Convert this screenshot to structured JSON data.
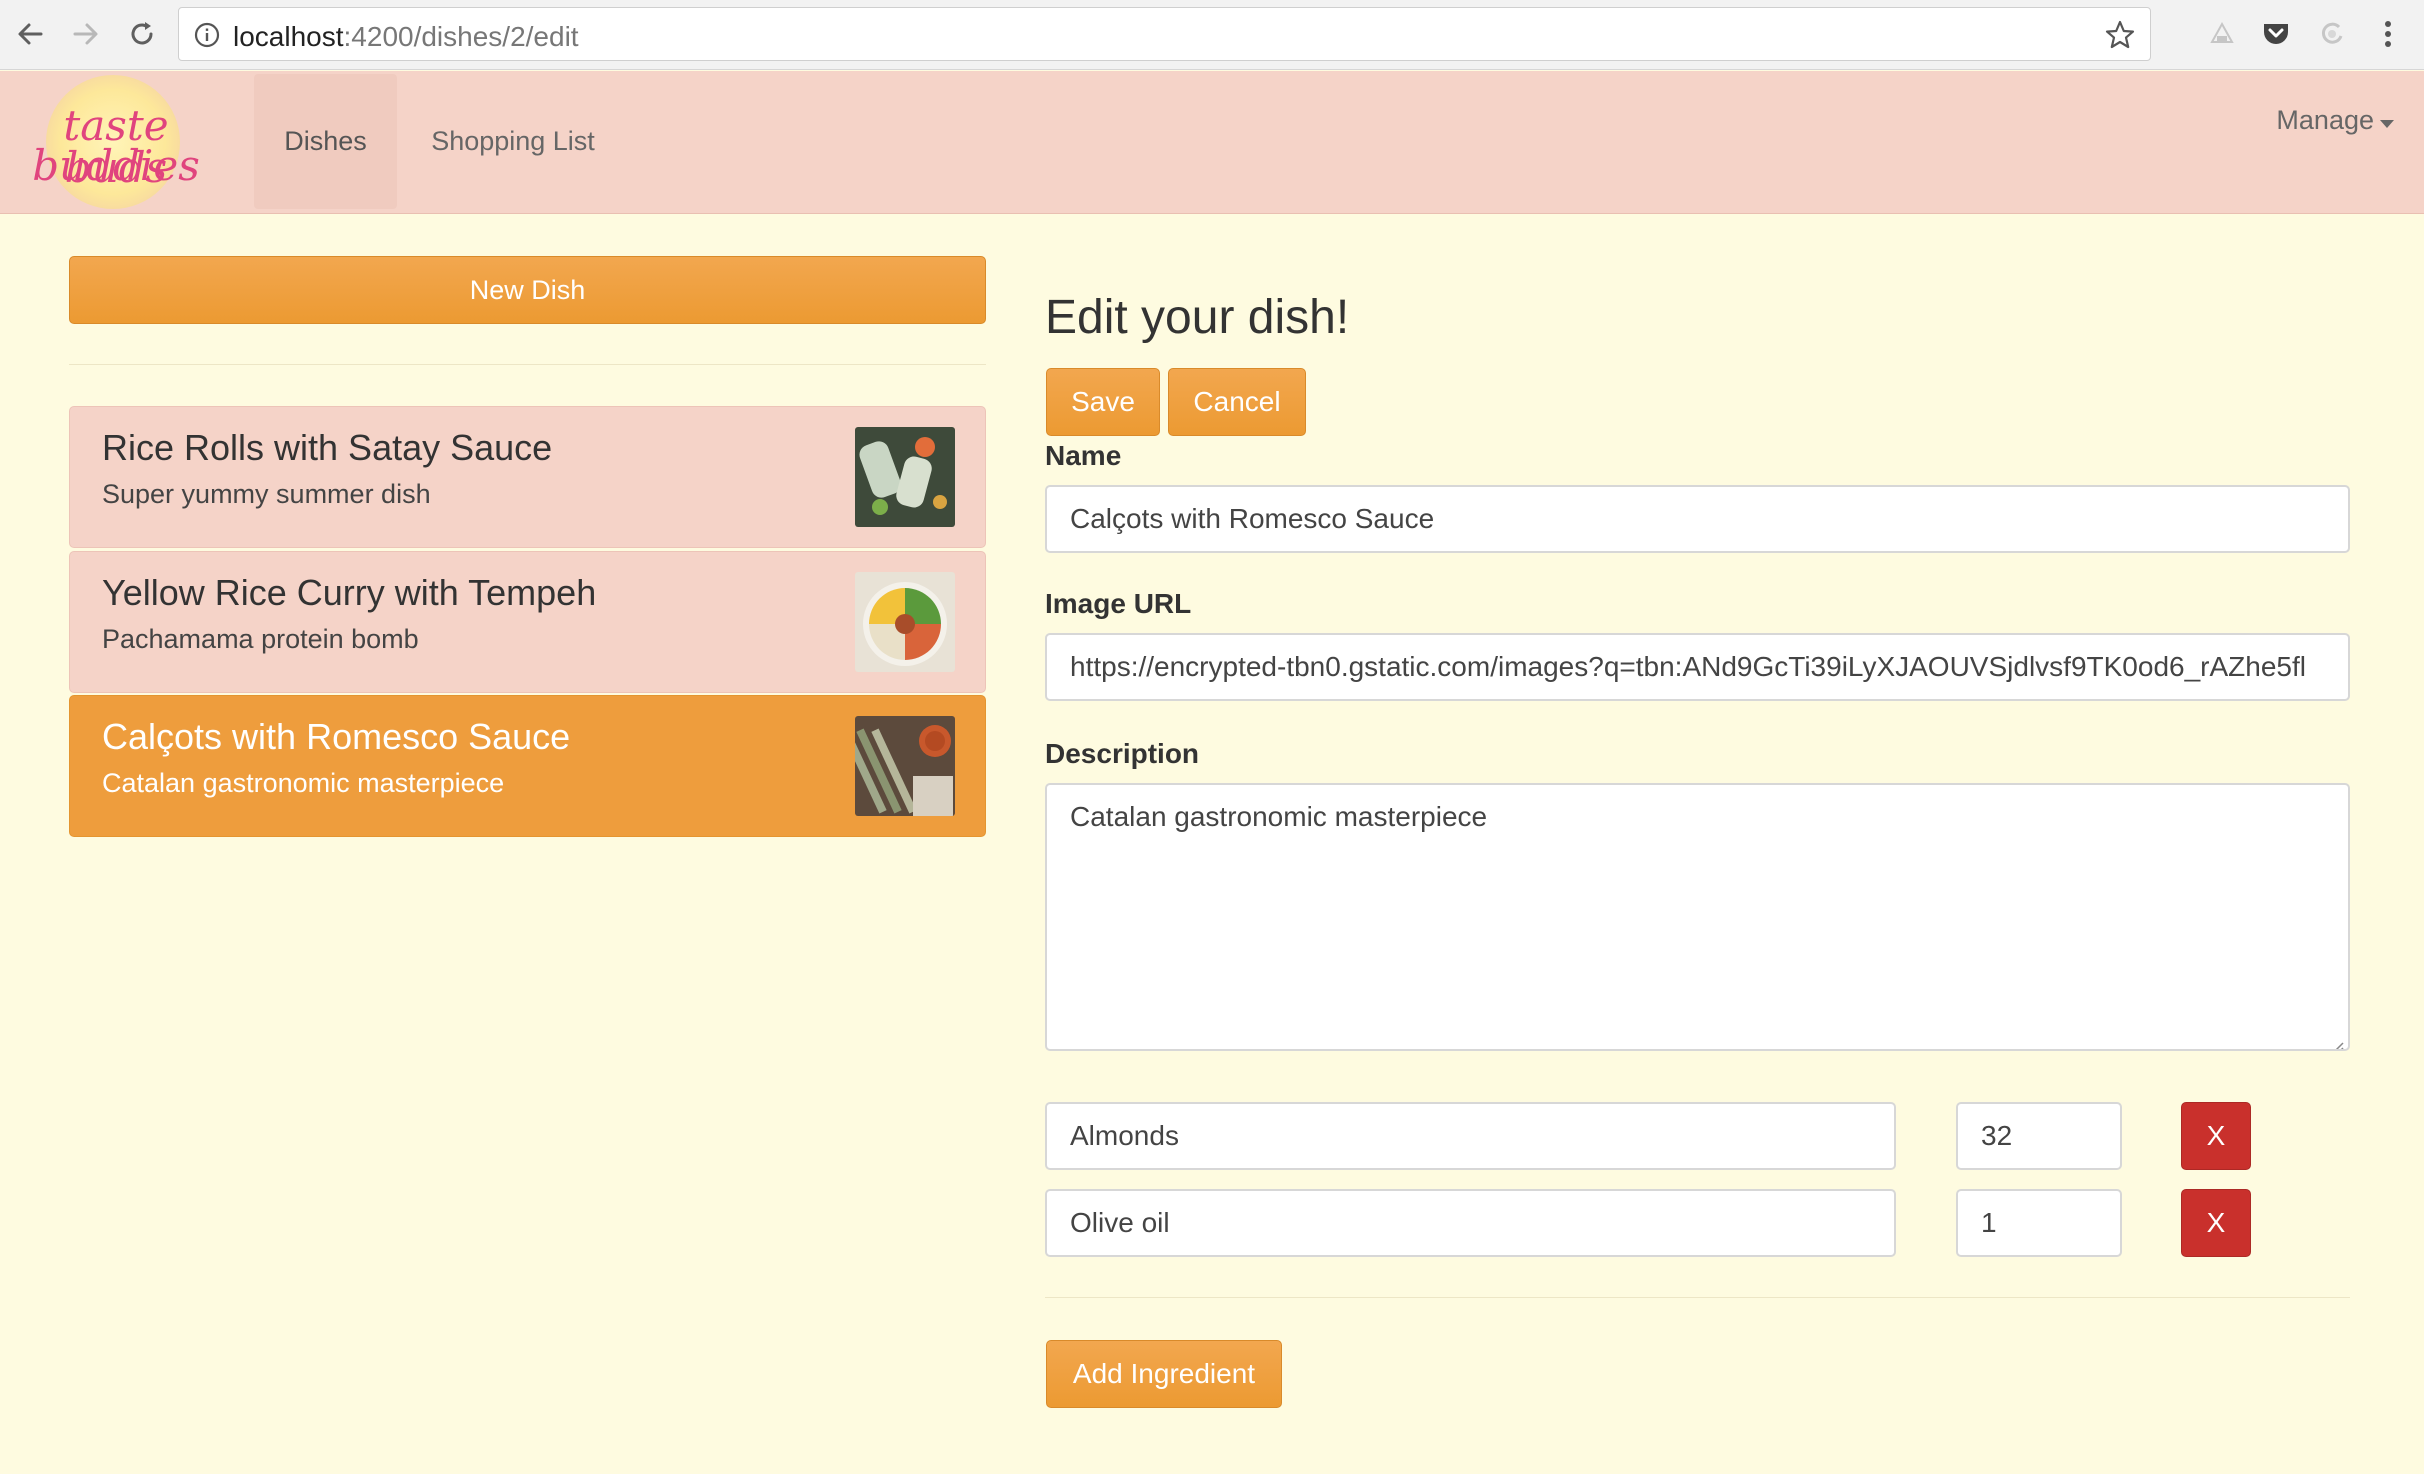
{
  "browser": {
    "url_host": "localhost",
    "url_path": ":4200/dishes/2/edit",
    "icons": [
      "back-arrow-icon",
      "forward-arrow-icon",
      "reload-icon",
      "info-icon",
      "star-icon",
      "extension-icon",
      "pocket-icon",
      "sync-icon",
      "menu-dots-icon"
    ]
  },
  "navbar": {
    "logo_line1": "taste buds",
    "logo_line2": "buddies",
    "tabs": [
      {
        "label": "Dishes",
        "active": true
      },
      {
        "label": "Shopping List",
        "active": false
      }
    ],
    "manage_label": "Manage"
  },
  "sidebar": {
    "new_dish_label": "New Dish",
    "dishes": [
      {
        "name": "Rice Rolls with Satay Sauce",
        "description": "Super yummy summer dish",
        "active": false
      },
      {
        "name": "Yellow Rice Curry with Tempeh",
        "description": "Pachamama protein bomb",
        "active": false
      },
      {
        "name": "Calçots with Romesco Sauce",
        "description": "Catalan gastronomic masterpiece",
        "active": true
      }
    ]
  },
  "edit_form": {
    "title": "Edit your dish!",
    "save_label": "Save",
    "cancel_label": "Cancel",
    "name_label": "Name",
    "name_value": "Calçots with Romesco Sauce",
    "image_url_label": "Image URL",
    "image_url_value": "https://encrypted-tbn0.gstatic.com/images?q=tbn:ANd9GcTi39iLyXJAOUVSjdlvsf9TK0od6_rAZhe5fl",
    "description_label": "Description",
    "description_value": "Catalan gastronomic masterpiece",
    "ingredients": [
      {
        "name": "Almonds",
        "amount": "32"
      },
      {
        "name": "Olive oil",
        "amount": "1"
      }
    ],
    "remove_label": "X",
    "add_ingredient_label": "Add Ingredient"
  },
  "colors": {
    "accent_orange": "#ec9a32",
    "navbar_pink": "#f5d3c8",
    "page_background": "#fefbe0",
    "danger_red": "#c9302c"
  }
}
